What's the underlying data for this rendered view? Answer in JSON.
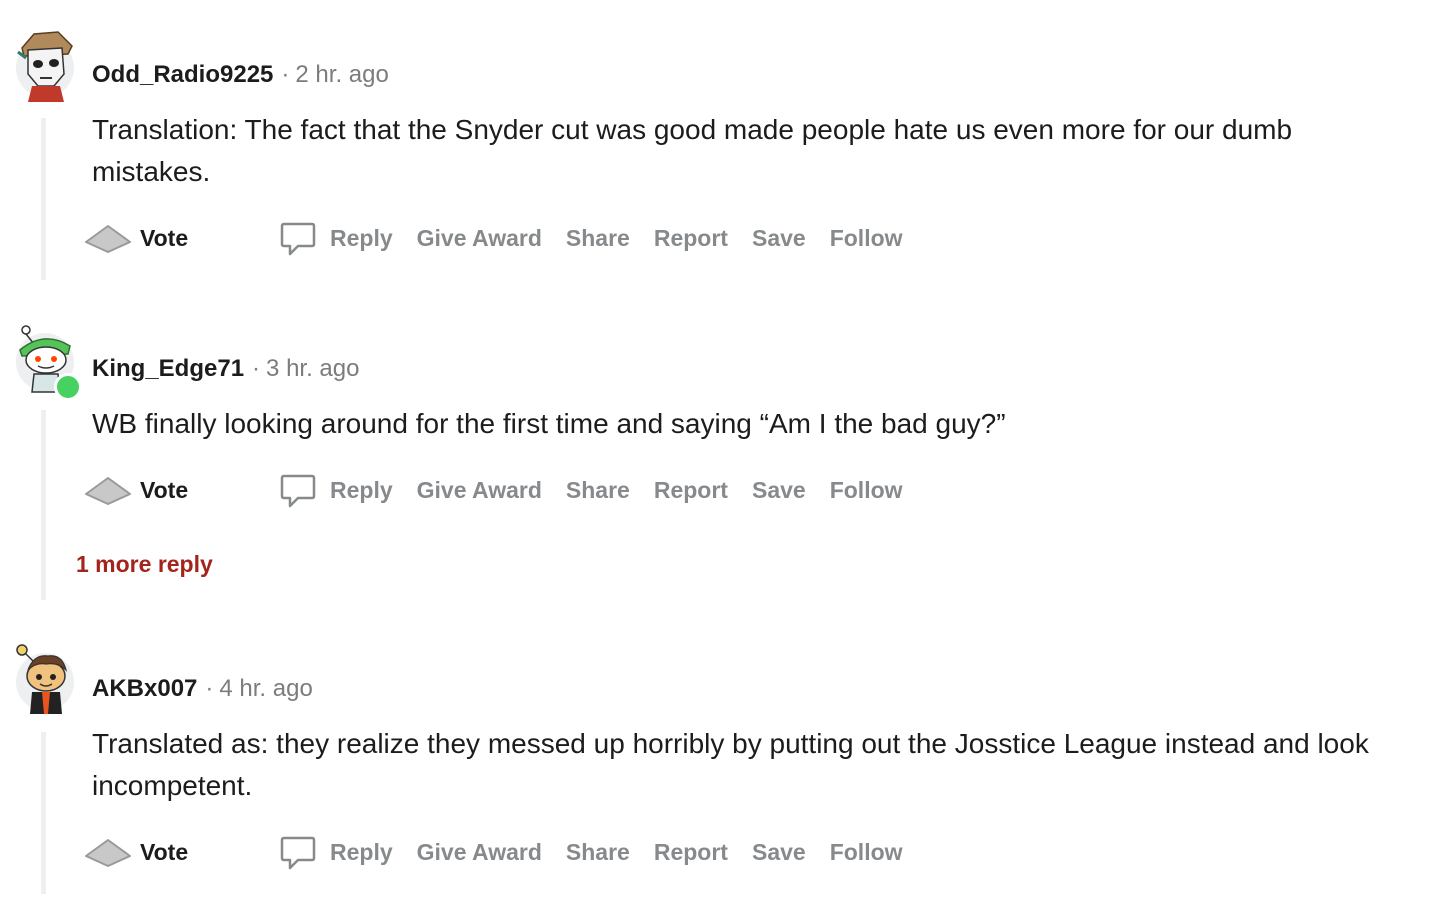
{
  "comments": [
    {
      "username": "Odd_Radio9225",
      "separator": "·",
      "time": "2 hr. ago",
      "body": "Translation: The fact that the Snyder cut was good made people hate us even more for our dumb mistakes.",
      "avatar_icon": "skull-mask-avatar-icon",
      "online": false,
      "more_replies": ""
    },
    {
      "username": "King_Edge71",
      "separator": "·",
      "time": "3 hr. ago",
      "body": "WB finally looking around for the first time and saying “Am I the bad guy?”",
      "avatar_icon": "snoo-green-hat-avatar-icon",
      "online": true,
      "more_replies": "1 more reply"
    },
    {
      "username": "AKBx007",
      "separator": "·",
      "time": "4 hr. ago",
      "body": "Translated as: they realize they messed up horribly by putting out the Josstice League instead and look incompetent.",
      "avatar_icon": "snoo-brown-hair-avatar-icon",
      "online": false,
      "more_replies": ""
    }
  ],
  "actions": {
    "vote": "Vote",
    "reply": "Reply",
    "give_award": "Give Award",
    "share": "Share",
    "report": "Report",
    "save": "Save",
    "follow": "Follow"
  },
  "colors": {
    "text": "#1c1c1c",
    "muted": "#878a8c",
    "more_replies": "#a3231d",
    "online": "#46d160",
    "thread_line": "#edeff1"
  }
}
